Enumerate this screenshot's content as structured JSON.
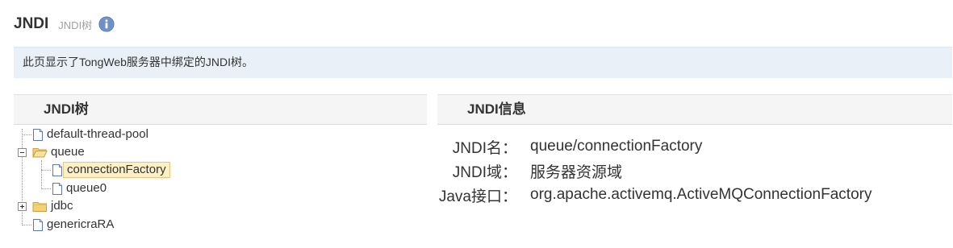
{
  "header": {
    "title": "JNDI",
    "subtitle": "JNDI树",
    "info_icon": "info-icon"
  },
  "notice": {
    "text": "此页显示了TongWeb服务器中绑定的JNDI树。"
  },
  "left_panel": {
    "title": "JNDI树",
    "tree": [
      {
        "label": "default-thread-pool",
        "type": "file",
        "depth": 0
      },
      {
        "label": "queue",
        "type": "folder",
        "depth": 0,
        "expanded": true
      },
      {
        "label": "connectionFactory",
        "type": "file",
        "depth": 1,
        "selected": true
      },
      {
        "label": "queue0",
        "type": "file",
        "depth": 1
      },
      {
        "label": "jdbc",
        "type": "folder",
        "depth": 0,
        "expanded": false
      },
      {
        "label": "genericraRA",
        "type": "file",
        "depth": 0
      }
    ]
  },
  "right_panel": {
    "title": "JNDI信息",
    "rows": [
      {
        "key": "JNDI名：",
        "value": "queue/connectionFactory"
      },
      {
        "key": "JNDI域：",
        "value": "服务器资源域"
      },
      {
        "key": "Java接口：",
        "value": "org.apache.activemq.ActiveMQConnectionFactory"
      }
    ]
  },
  "colors": {
    "notice_bg": "#e9f0f8",
    "panel_header_bg": "#f5f5f5",
    "selected_bg": "#fdf0c6",
    "selected_border": "#e9c77a",
    "info_icon": "#6f8fc8"
  }
}
